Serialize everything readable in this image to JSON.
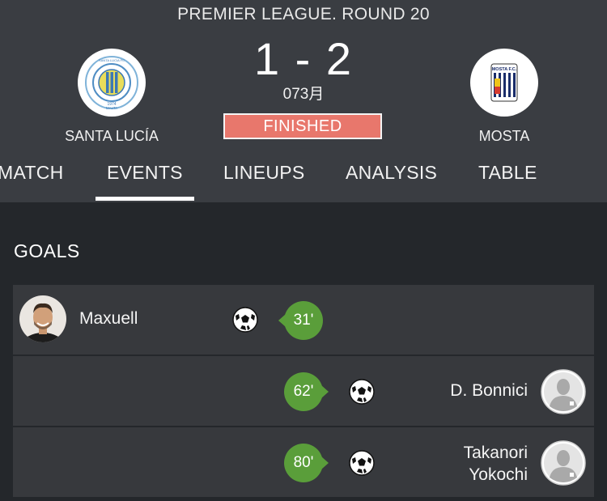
{
  "match": {
    "competition": "PREMIER LEAGUE. ROUND 20",
    "score": "1 - 2",
    "date": "073月",
    "status": "FINISHED",
    "home_team": {
      "name": "SANTA LUCÍA",
      "logo_icon": "santa-lucia-crest",
      "logo_text_top": "SANTA LUCIA FC",
      "logo_text_year": "1974",
      "logo_text_bottom": "MALTA"
    },
    "away_team": {
      "name": "MOSTA",
      "logo_icon": "mosta-crest",
      "logo_text": "MOSTA F.C."
    }
  },
  "tabs": [
    {
      "label": "MATCH",
      "active": false
    },
    {
      "label": "EVENTS",
      "active": true
    },
    {
      "label": "LINEUPS",
      "active": false
    },
    {
      "label": "ANALYSIS",
      "active": false
    },
    {
      "label": "TABLE",
      "active": false
    }
  ],
  "goals": {
    "title": "GOALS",
    "events": [
      {
        "player": "Maxuell",
        "minute": "31'",
        "side": "home",
        "avatar": "player-photo"
      },
      {
        "player": "D. Bonnici",
        "minute": "62'",
        "side": "away",
        "avatar": "player-silhouette"
      },
      {
        "player_line1": "Takanori",
        "player_line2": "Yokochi",
        "minute": "80'",
        "side": "away",
        "avatar": "player-silhouette"
      }
    ]
  },
  "colors": {
    "header_bg": "#3a3d42",
    "page_bg": "#24272b",
    "row_bg": "#37393d",
    "status_bg": "#e8776c",
    "minute_badge": "#5a9e3a"
  }
}
